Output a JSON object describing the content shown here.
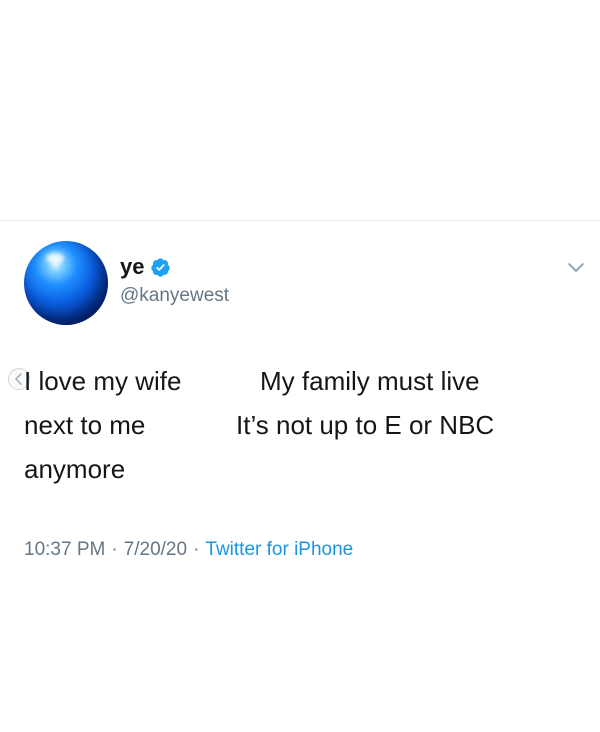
{
  "tweet": {
    "display_name": "ye",
    "handle": "@kanyewest",
    "lines": [
      [
        "I love my wife",
        "My family must live"
      ],
      [
        "next to me",
        "It’s not up to E or NBC"
      ],
      [
        "anymore",
        ""
      ]
    ],
    "time": "10:37 PM",
    "separator": "·",
    "date": "7/20/20",
    "source": "Twitter for iPhone"
  },
  "icons": {
    "avatar": "blue-sphere-avatar",
    "verified": "verified-badge-icon",
    "menu": "chevron-down-icon",
    "nav": "chevron-left-icon"
  },
  "colors": {
    "text": "#14171a",
    "secondary": "#657786",
    "link": "#1b95e0",
    "divider": "#e6ecf0"
  }
}
